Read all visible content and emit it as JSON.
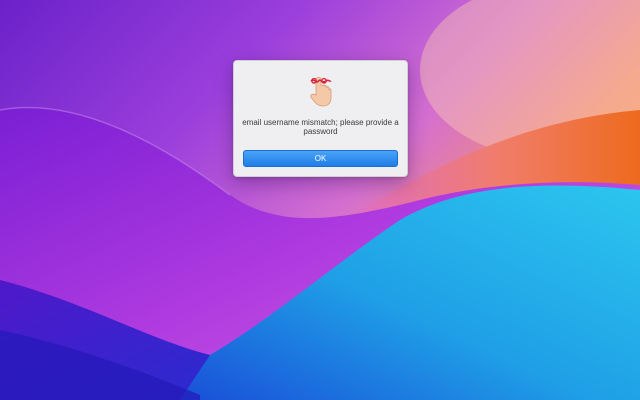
{
  "dialog": {
    "icon": "finger-with-ribbon-reminder-icon",
    "message": "email username mismatch; please provide a password",
    "ok_label": "OK"
  },
  "colors": {
    "button_top": "#4aa3f8",
    "button_bottom": "#1f7ee6",
    "dialog_background": "#efeff1"
  }
}
